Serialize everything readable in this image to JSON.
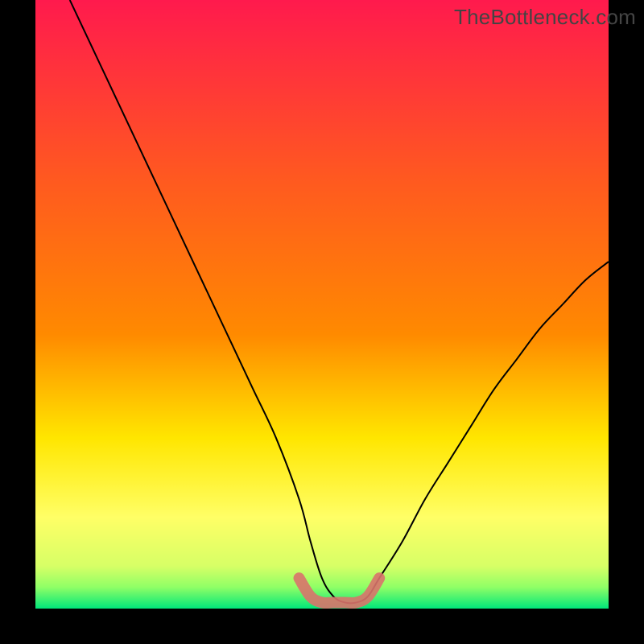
{
  "watermark": "TheBottleneck.com",
  "chart_data": {
    "type": "line",
    "title": "",
    "xlabel": "",
    "ylabel": "",
    "xlim": [
      0,
      100
    ],
    "ylim": [
      0,
      100
    ],
    "background_gradient": {
      "top": "#ff1a4d",
      "mid1": "#ff8a00",
      "mid2": "#ffe600",
      "mid3": "#ffff66",
      "bottom": "#00e67a"
    },
    "series": [
      {
        "name": "bottleneck-curve",
        "color": "#000000",
        "x": [
          6,
          10,
          14,
          18,
          22,
          26,
          30,
          34,
          38,
          42,
          46,
          48,
          50,
          52,
          54,
          56,
          58,
          60,
          64,
          68,
          72,
          76,
          80,
          84,
          88,
          92,
          96,
          100
        ],
        "y": [
          100,
          92,
          84,
          76,
          68,
          60,
          52,
          44,
          36,
          28,
          18,
          11,
          5,
          2,
          1,
          1,
          2,
          5,
          11,
          18,
          24,
          30,
          36,
          41,
          46,
          50,
          54,
          57
        ]
      },
      {
        "name": "sweet-spot-band",
        "color": "#d9736b",
        "x": [
          46,
          48,
          50,
          52,
          54,
          56,
          58,
          60
        ],
        "y": [
          5,
          2,
          1,
          1,
          1,
          1,
          2,
          5
        ]
      }
    ],
    "border_color": "#000000",
    "border_width_frac": 0.055
  }
}
